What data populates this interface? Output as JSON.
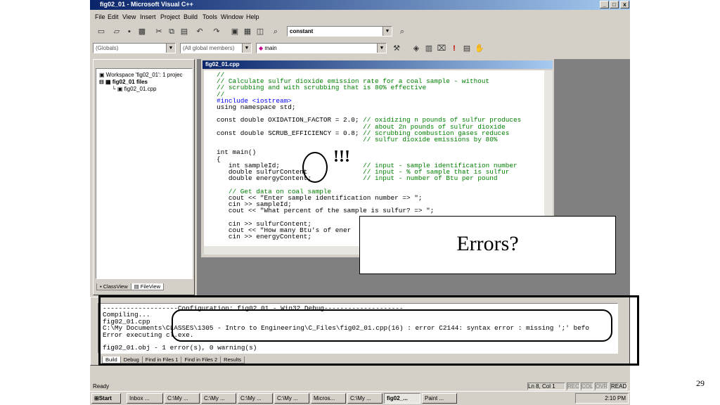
{
  "window": {
    "title": "fig02_01 - Microsoft Visual C++",
    "min": "_",
    "max": "□",
    "close": "x"
  },
  "menu": [
    "File",
    "Edit",
    "View",
    "Insert",
    "Project",
    "Build",
    "Tools",
    "Window",
    "Help"
  ],
  "toolbar": {
    "find_combo": "constant"
  },
  "wizardbar": {
    "class_combo": "(Globals)",
    "members_combo": "(All global members)",
    "function_combo": "main"
  },
  "workspace": {
    "root": "Workspace 'fig02_01': 1 projec",
    "project": "fig02_01 files",
    "file": "fig02_01.cpp",
    "tab_classview": "ClassView",
    "tab_fileview": "FileView"
  },
  "editor": {
    "title": "fig02_01.cpp",
    "lines": [
      {
        "t": "//",
        "c": "cm"
      },
      {
        "t": "// Calculate sulfur dioxide emission rate for a coal sample - without",
        "c": "cm"
      },
      {
        "t": "// scrubbing and with scrubbing that is 80% effective",
        "c": "cm"
      },
      {
        "t": "//",
        "c": "cm"
      },
      {
        "t": "#include <iostream>",
        "c": "kw"
      },
      {
        "t": "using namespace std;",
        "c": ""
      },
      {
        "t": "",
        "c": ""
      },
      {
        "t": "const double OXIDATION_FACTOR = 2.0; // oxidizing n pounds of sulfur produces",
        "c": ""
      },
      {
        "t": "                                     // about 2n pounds of sulfur dioxide",
        "c": "cm"
      },
      {
        "t": "const double SCRUB_EFFICIENCY = 0.8; // scrubbing combustion gases reduces",
        "c": ""
      },
      {
        "t": "                                     // sulfur dioxide emissions by 80%",
        "c": "cm"
      },
      {
        "t": "",
        "c": ""
      },
      {
        "t": "int main()",
        "c": ""
      },
      {
        "t": "{",
        "c": ""
      },
      {
        "t": "   int sampleId;                     // input - sample identification number",
        "c": ""
      },
      {
        "t": "   double sulfurContent              // input - % of sample that is sulfur",
        "c": ""
      },
      {
        "t": "   double energyContent;             // input - number of Btu per pound",
        "c": ""
      },
      {
        "t": "",
        "c": ""
      },
      {
        "t": "   // Get data on coal sample",
        "c": "cm"
      },
      {
        "t": "   cout << \"Enter sample identification number => \";",
        "c": ""
      },
      {
        "t": "   cin >> sampleId;",
        "c": ""
      },
      {
        "t": "   cout << \"What percent of the sample is sulfur? => \";",
        "c": ""
      },
      {
        "t": "",
        "c": ""
      },
      {
        "t": "   cin >> sulfurContent;",
        "c": ""
      },
      {
        "t": "   cout << \"How many Btu's of ener",
        "c": ""
      },
      {
        "t": "   cin >> energyContent;",
        "c": ""
      }
    ]
  },
  "output": {
    "lines": [
      "-------------------Configuration: fig02_01 - Win32 Debug--------------------",
      "Compiling...",
      "fig02_01.cpp",
      "C:\\My Documents\\CLASSES\\1305 - Intro to Engineering\\C_Files\\fig02_01.cpp(16) : error C2144: syntax error : missing ';' befo",
      "Error executing cl.exe.",
      "",
      "fig02_01.obj - 1 error(s), 0 warning(s)"
    ],
    "tabs": [
      "Build",
      "Debug",
      "Find in Files 1",
      "Find in Files 2",
      "Results"
    ]
  },
  "status": {
    "ready": "Ready",
    "position": "Ln 8, Col 1",
    "rec": "REC",
    "col": "COL",
    "ovr": "OVR",
    "read": "READ"
  },
  "taskbar": {
    "start": "Start",
    "tasks": [
      "Inbox ...",
      "C:\\My ...",
      "C:\\My ...",
      "C:\\My ...",
      "C:\\My ...",
      "Micros...",
      "C:\\My ...",
      "fig02_...",
      "Paint ..."
    ],
    "clock": "2:10 PM"
  },
  "overlay": {
    "errors_label": "Errors?",
    "bangs": "!!!"
  },
  "slide_number": "29"
}
